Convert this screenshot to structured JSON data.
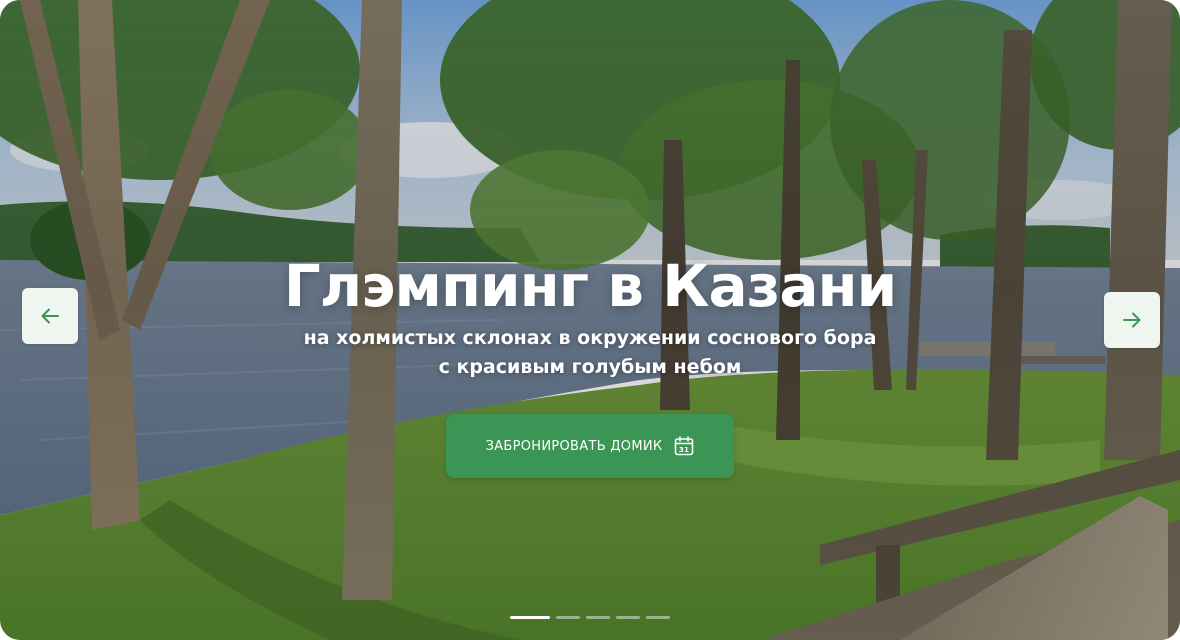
{
  "hero": {
    "title": "Глэмпинг в Казани",
    "subtitle_line1": "на холмистых склонах в окружении соснового бора",
    "subtitle_line2": "с красивым голубым небом",
    "background_image": "lakeside-pine-forest-photo"
  },
  "cta": {
    "label": "ЗАБРОНИРОВАТЬ ДОМИК",
    "icon": "calendar-icon",
    "calendar_day": "31",
    "color": "#3b9554"
  },
  "nav": {
    "prev_icon": "arrow-left-icon",
    "next_icon": "arrow-right-icon",
    "button_bg": "#eef6ef",
    "arrow_color": "#3b9554"
  },
  "slider": {
    "total_slides": 5,
    "active_index": 0
  }
}
